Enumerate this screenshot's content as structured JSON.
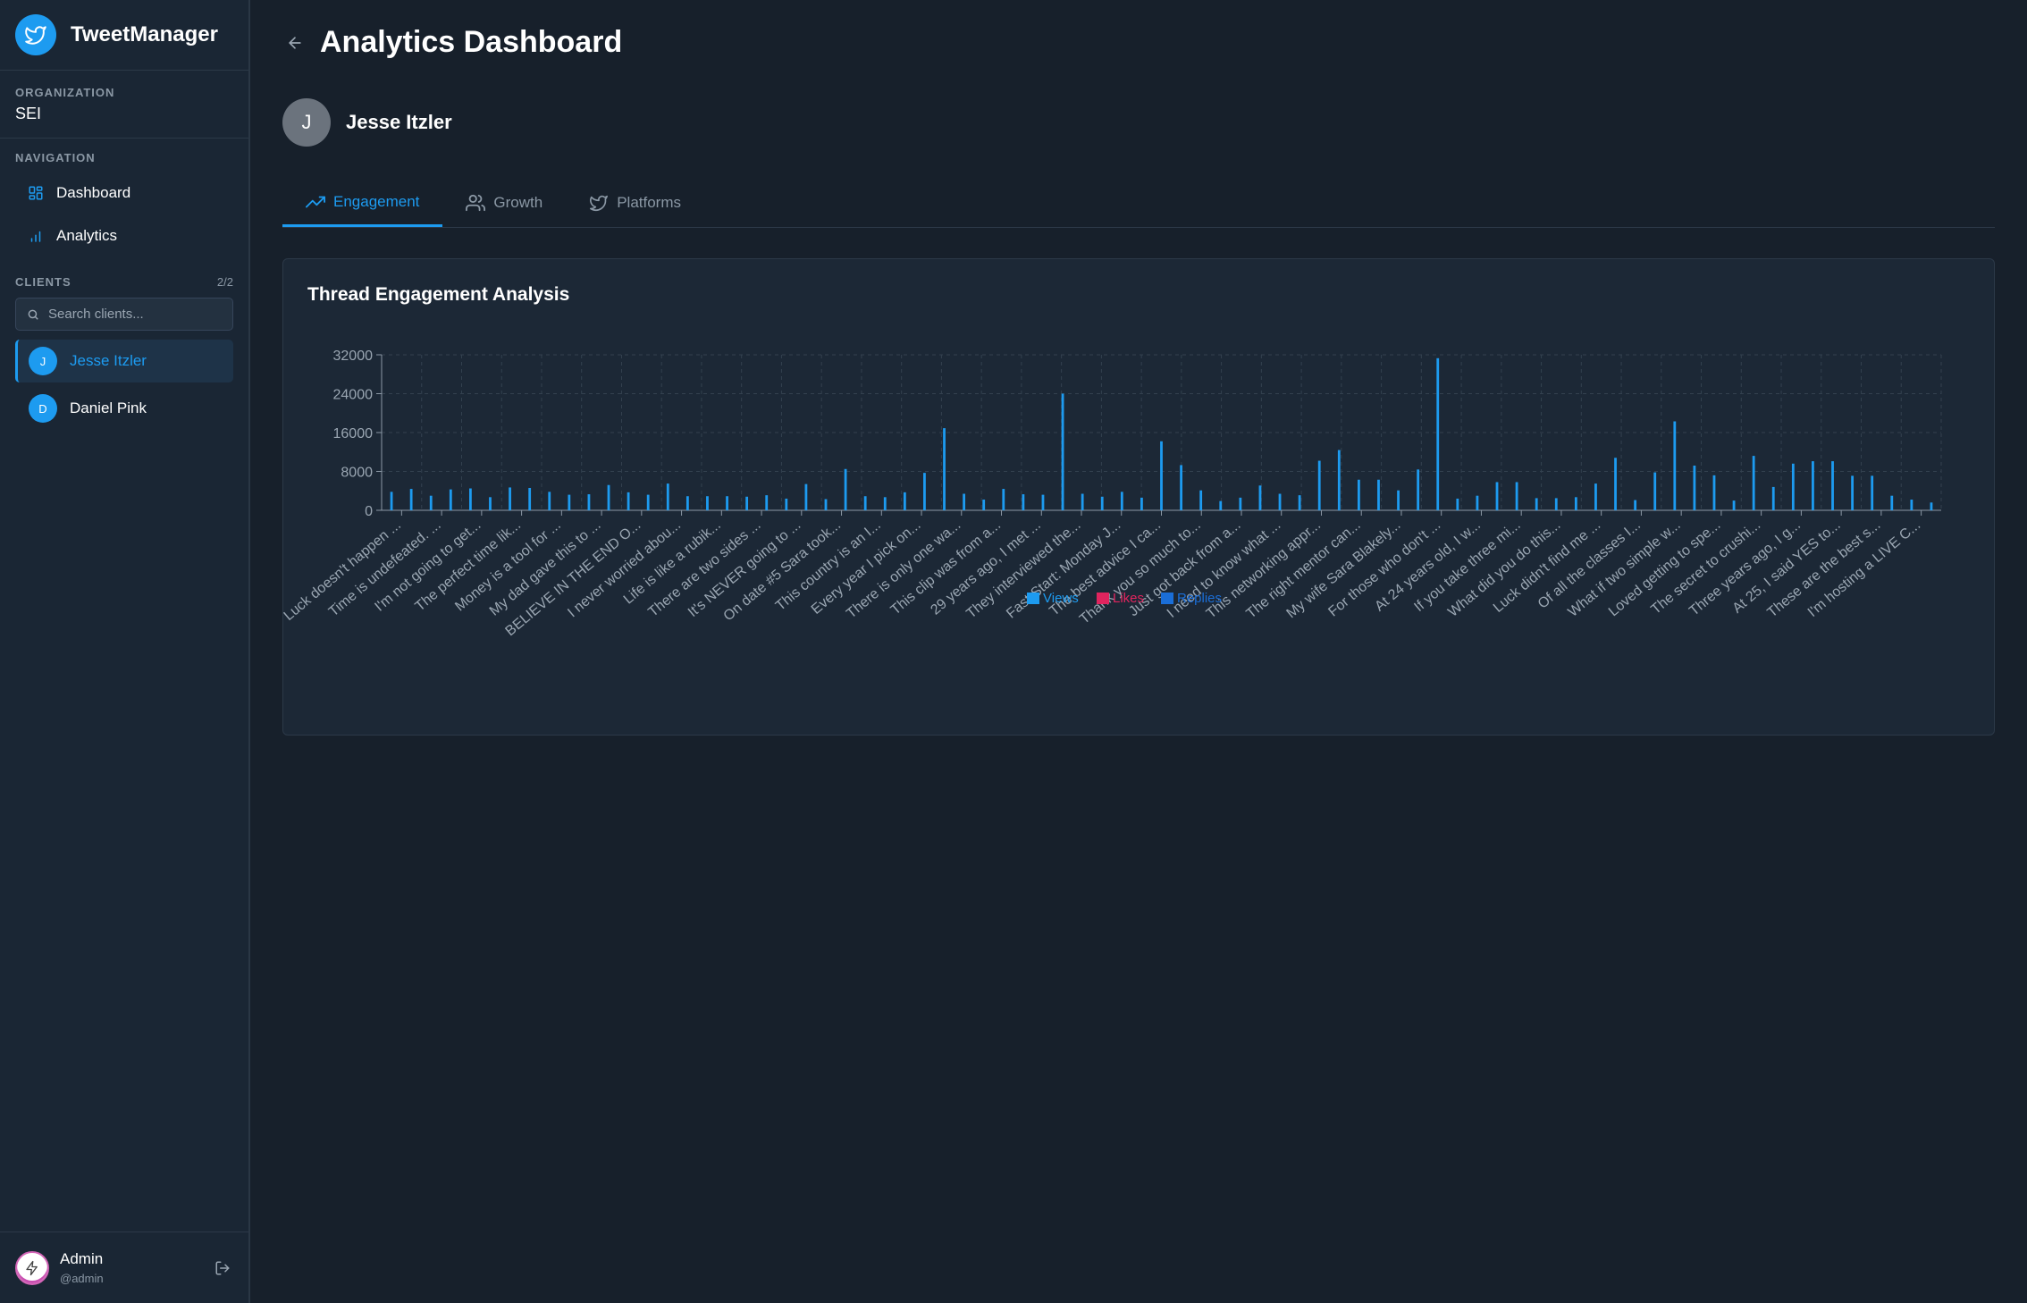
{
  "app": {
    "name": "TweetManager",
    "logo_icon": "twitter-bird-icon"
  },
  "organization": {
    "label": "ORGANIZATION",
    "name": "SEI"
  },
  "navigation": {
    "label": "NAVIGATION",
    "items": [
      {
        "label": "Dashboard",
        "icon": "grid-icon"
      },
      {
        "label": "Analytics",
        "icon": "bar-chart-icon"
      }
    ]
  },
  "clients": {
    "label": "CLIENTS",
    "count": "2/2",
    "search_placeholder": "Search clients...",
    "items": [
      {
        "initial": "J",
        "name": "Jesse Itzler",
        "active": true
      },
      {
        "initial": "D",
        "name": "Daniel Pink",
        "active": false
      }
    ]
  },
  "user": {
    "name": "Admin",
    "handle": "@admin"
  },
  "page": {
    "title": "Analytics Dashboard"
  },
  "profile": {
    "initial": "J",
    "name": "Jesse Itzler"
  },
  "tabs": [
    {
      "label": "Engagement",
      "icon": "trending-up-icon",
      "active": true
    },
    {
      "label": "Growth",
      "icon": "users-icon",
      "active": false
    },
    {
      "label": "Platforms",
      "icon": "twitter-icon",
      "active": false
    }
  ],
  "colors": {
    "accent": "#1d9bf0",
    "views": "#1d9bf0",
    "likes": "#e0245e",
    "replies": "#1a6ed8"
  },
  "chart_data": {
    "type": "bar",
    "title": "Thread Engagement Analysis",
    "ylim": [
      0,
      32000
    ],
    "yticks": [
      0,
      8000,
      16000,
      24000,
      32000
    ],
    "grid": true,
    "legend_position": "center",
    "categories": [
      "Luck doesn't happen ...",
      "Time is undefeated. ...",
      "I'm not going to get...",
      "The perfect time lik...",
      "Money is a tool for ...",
      "My dad gave this to ...",
      "BELIEVE IN THE END O...",
      "I never worried abou...",
      "Life is like a rubik...",
      "There are two sides ...",
      "It's NEVER going to ...",
      "On date #5 Sara took...",
      "This country is an I...",
      "Every year I pick on...",
      "There is only one wa...",
      "This clip was from a...",
      "29 years ago, I met ...",
      "They interviewed the...",
      "Fast Start: Monday J...",
      "The best advice I ca...",
      "Thank you so much to...",
      "Just got back from a...",
      "I need to know what ...",
      "This networking appr...",
      "The right mentor can...",
      "My wife Sara Blakely...",
      "For those who don't ...",
      "At 24 years old, I w...",
      "If you take three mi...",
      "What did you do this...",
      "Luck didn't find me ...",
      "Of all the classes I...",
      "What if two simple w...",
      "Loved getting to spe...",
      "The secret to crushi...",
      "Three years ago, I g...",
      "At 25, I said YES to...",
      "These are the best s...",
      "I'm hosting a LIVE C..."
    ],
    "series": [
      {
        "name": "Views",
        "values": [
          3800,
          4400,
          3000,
          4300,
          4500,
          2700,
          4700,
          4600,
          3800,
          3200,
          3300,
          5200,
          3700,
          3200,
          5500,
          2900,
          2900,
          2900,
          2800,
          3100,
          2400,
          5400,
          2300,
          8500,
          2900,
          2700,
          3700,
          7700,
          16900,
          3400,
          2200,
          4400,
          3300,
          3200,
          24000,
          3400,
          2800,
          3800,
          2600,
          14200,
          9300,
          4100,
          1900,
          2600,
          5100,
          3400,
          3100,
          10200,
          12400,
          6300,
          6300,
          4100,
          8400,
          31300,
          2400,
          3000,
          5800,
          5800,
          2500,
          2500,
          2700,
          5500,
          10800,
          2100,
          7800,
          18300,
          9200,
          7200,
          2000,
          11200,
          4800,
          9600,
          10100,
          10100,
          7100,
          7100,
          3000,
          2200,
          1600
        ]
      },
      {
        "name": "Likes",
        "values": []
      },
      {
        "name": "Replies",
        "values": []
      }
    ]
  }
}
